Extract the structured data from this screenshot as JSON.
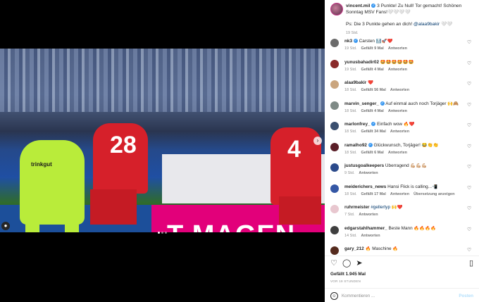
{
  "caption": {
    "username": "vincent.mil",
    "text": " 3 Punkte! Zu Null! Tor gemacht! Schönen Sonntag MSV Fans!🤍🤍🤍🤍",
    "ps_prefix": "Ps: Die 3 Punkte gehen an dich! ",
    "mention": "@alaa9bakir",
    "ps_suffix": " 🤍🤍",
    "age": "19 Std."
  },
  "comments": [
    {
      "username": "nk3",
      "verified": true,
      "text": "Carsten 🔝🚀❤️",
      "age": "19 Std.",
      "likes": "Gefällt 9 Mal",
      "reply": "Antworten",
      "avatar_color": "#6b6b6b"
    },
    {
      "username": "yunusbahadir02",
      "verified": false,
      "text": "🤩🤩🤩🤩🤩🤩",
      "age": "19 Std.",
      "likes": "Gefällt 4 Mal",
      "reply": "Antworten",
      "avatar_color": "#8a2a2a"
    },
    {
      "username": "alaa9bakir",
      "verified": false,
      "text": "❤️",
      "age": "18 Std.",
      "likes": "Gefällt 56 Mal",
      "reply": "Antworten",
      "avatar_color": "#caa57e"
    },
    {
      "username": "marvin_senger_",
      "verified": true,
      "text": "Auf einmal auch noch Torjäger 🙌🙈",
      "age": "18 Std.",
      "likes": "Gefällt 4 Mal",
      "reply": "Antworten",
      "avatar_color": "#7f8a86"
    },
    {
      "username": "marlonfrey_",
      "verified": true,
      "text": "Einfach wow 🔥❤️",
      "age": "18 Std.",
      "likes": "Gefällt 34 Mal",
      "reply": "Antworten",
      "avatar_color": "#3a4f6f"
    },
    {
      "username": "ramalho92",
      "verified": true,
      "text": "Glückwunsch, Torjäger! 😂👏👏",
      "age": "18 Std.",
      "likes": "Gefällt 6 Mal",
      "reply": "Antworten",
      "avatar_color": "#5a1e28"
    },
    {
      "username": "justusgoalkeepers",
      "verified": false,
      "text": "Überragend 💪🏼💪🏼💪🏼",
      "age": "9 Std.",
      "likes": "",
      "reply": "Antworten",
      "avatar_color": "#2b4a8b"
    },
    {
      "username": "meiderichers_news",
      "verified": false,
      "text": "Hansi Flick is calling...📲",
      "age": "18 Std.",
      "likes": "Gefällt 17 Mal",
      "reply": "Antworten",
      "extra": "Übersetzung anzeigen",
      "avatar_color": "#3557a5"
    },
    {
      "username": "ruhrmeister",
      "verified": false,
      "text": "",
      "mention": "#gellertyp",
      "text2": " 🙌❤️",
      "age": "7 Std.",
      "likes": "",
      "reply": "Antworten",
      "avatar_color": "#e8c7cf"
    },
    {
      "username": "edgarstahlhammer_",
      "verified": false,
      "text": "Beste Mann 🔥🔥🔥🔥",
      "age": "14 Std.",
      "likes": "",
      "reply": "Antworten",
      "avatar_color": "#3f3f3f"
    },
    {
      "username": "gary_212",
      "verified": false,
      "text": "🔥 Maschine 🔥",
      "age": "",
      "likes": "",
      "reply": "",
      "avatar_color": "#552b1e"
    }
  ],
  "photo": {
    "ad_text": "T MAGEN",
    "p28_number": "28",
    "p4_number": "4",
    "sponsor": "trinkgut"
  },
  "footer": {
    "likes": "Gefällt 1.945 Mal",
    "date": "VOR 19 STUNDEN",
    "comment_placeholder": "Kommentieren ...",
    "post_label": "Posten"
  }
}
